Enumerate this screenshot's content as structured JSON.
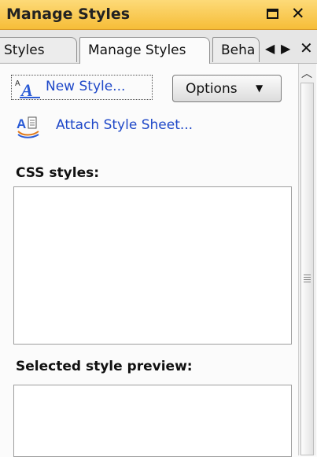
{
  "window": {
    "title": "Manage Styles"
  },
  "tabs": [
    {
      "label": "Styles"
    },
    {
      "label": "Manage Styles"
    },
    {
      "label": "Beha"
    }
  ],
  "toolbar": {
    "new_style_label": "New Style...",
    "options_label": "Options",
    "attach_label": "Attach Style Sheet..."
  },
  "sections": {
    "css_styles_label": "CSS styles:",
    "preview_label": "Selected style preview:"
  },
  "colors": {
    "title_bar": "#f6bd38",
    "link_text": "#1f48c8"
  }
}
